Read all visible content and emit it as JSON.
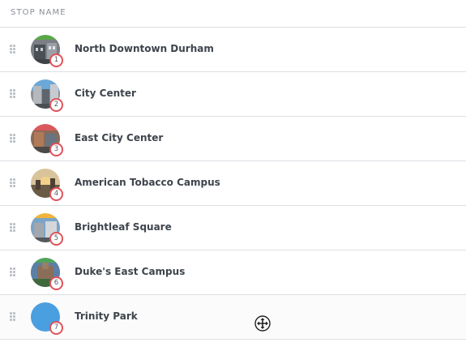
{
  "table": {
    "header": "Stop Name",
    "stops": [
      {
        "number": "1",
        "name": "North Downtown Durham",
        "avatar_icon": "photo-thumbnail-icon",
        "ring_color": "#5aa84b"
      },
      {
        "number": "2",
        "name": "City Center",
        "avatar_icon": "photo-thumbnail-icon",
        "ring_color": "#4a90c8"
      },
      {
        "number": "3",
        "name": "East City Center",
        "avatar_icon": "photo-thumbnail-icon",
        "ring_color": "#e0525a"
      },
      {
        "number": "4",
        "name": "American Tobacco Campus",
        "avatar_icon": "photo-thumbnail-icon",
        "ring_color": "#d8b25a"
      },
      {
        "number": "5",
        "name": "Brightleaf Square",
        "avatar_icon": "photo-thumbnail-icon",
        "ring_color": "#f0b43c"
      },
      {
        "number": "6",
        "name": "Duke's East Campus",
        "avatar_icon": "photo-thumbnail-icon",
        "ring_color": "#4fa45a"
      },
      {
        "number": "7",
        "name": "Trinity Park",
        "avatar_icon": "placeholder-circle-icon",
        "ring_color": "#4a9fe0"
      }
    ]
  },
  "colors": {
    "badge_border": "#e0525a",
    "divider": "#dcdfe3",
    "text": "#3e444c",
    "header_text": "#8a9099"
  },
  "cursor": {
    "icon": "move-cursor-icon"
  }
}
